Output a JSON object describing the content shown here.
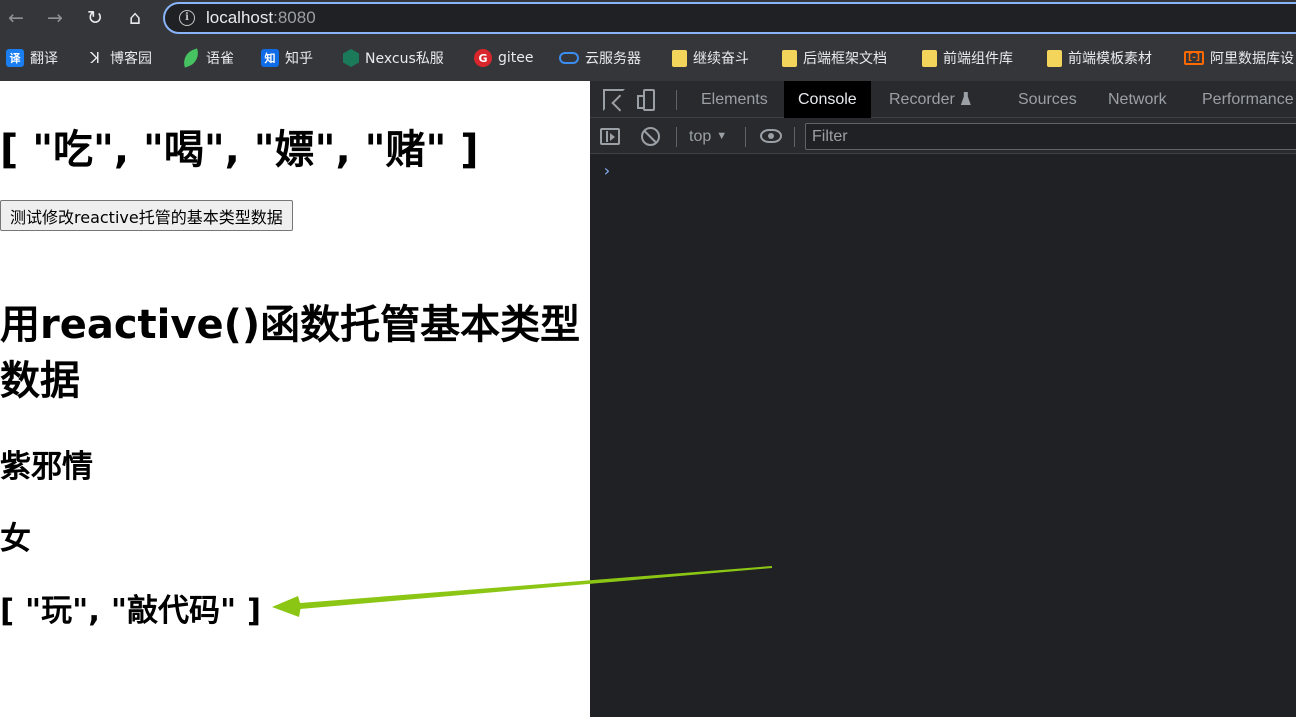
{
  "browser": {
    "url_host": "localhost",
    "url_port": ":8080",
    "bookmarks": [
      {
        "icon": "translate-icon",
        "glyph": "译",
        "label": "翻译"
      },
      {
        "icon": "cnblogs-icon",
        "glyph": "ꓘ",
        "label": "博客园"
      },
      {
        "icon": "yuque-icon",
        "glyph": "",
        "label": "语雀"
      },
      {
        "icon": "zhihu-icon",
        "glyph": "知",
        "label": "知乎"
      },
      {
        "icon": "nexus-icon",
        "glyph": "",
        "label": "Nexcus私服"
      },
      {
        "icon": "gitee-icon",
        "glyph": "G",
        "label": "gitee"
      },
      {
        "icon": "cloud-icon",
        "glyph": "",
        "label": "云服务器"
      },
      {
        "icon": "folder-icon",
        "glyph": "",
        "label": "继续奋斗"
      },
      {
        "icon": "folder-icon",
        "glyph": "",
        "label": "后端框架文档"
      },
      {
        "icon": "folder-icon",
        "glyph": "",
        "label": "前端组件库"
      },
      {
        "icon": "folder-icon",
        "glyph": "",
        "label": "前端模板素材"
      },
      {
        "icon": "aliyun-icon",
        "glyph": "[-]",
        "label": "阿里数据库设"
      }
    ]
  },
  "page": {
    "array_text": "[ \"吃\", \"喝\", \"嫖\", \"赌\" ]",
    "button_label": "测试修改reactive托管的基本类型数据",
    "heading": "用reactive()函数托管基本类型数据",
    "name": "紫邪情",
    "gender": "女",
    "hobby": "[ \"玩\", \"敲代码\" ]"
  },
  "devtools": {
    "tabs": [
      "Elements",
      "Console",
      "Recorder",
      "Sources",
      "Network",
      "Performance"
    ],
    "active_tab": "Console",
    "context": "top",
    "filter_placeholder": "Filter",
    "prompt": "›"
  },
  "colors": {
    "arrow": "#8cc614",
    "chrome_bg": "#35363a",
    "devtools_bg": "#202124"
  }
}
